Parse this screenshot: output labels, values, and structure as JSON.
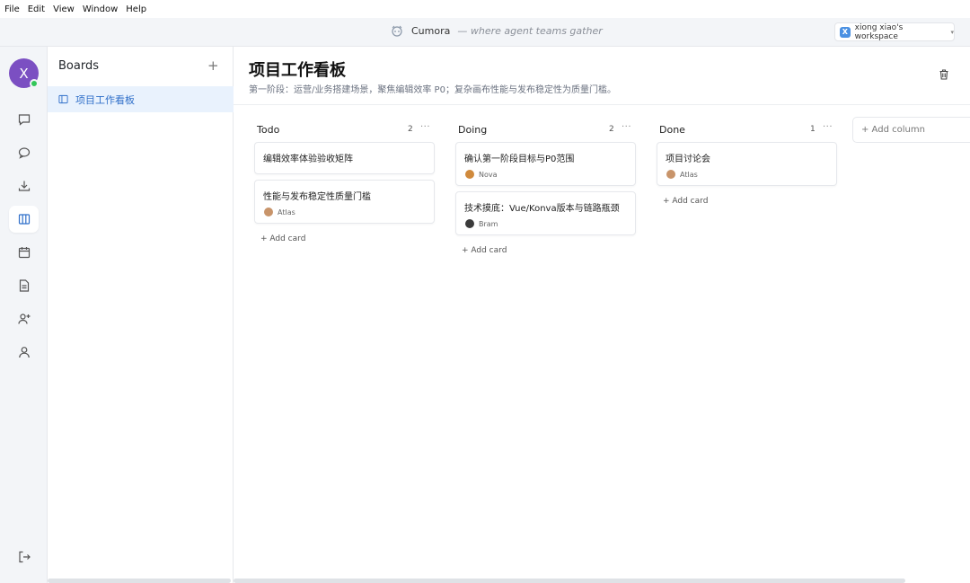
{
  "menubar": {
    "items": [
      "File",
      "Edit",
      "View",
      "Window",
      "Help"
    ]
  },
  "titlebar": {
    "app_name": "Cumora",
    "tagline": "— where agent teams gather",
    "workspace_initial": "X",
    "workspace_name": "xiong xiao's workspace"
  },
  "rail": {
    "user_initial": "X",
    "icons": [
      "chat-bubble-icon",
      "message-icon",
      "inbox-download-icon",
      "board-columns-icon",
      "calendar-icon",
      "document-icon",
      "add-user-icon",
      "user-icon",
      "logout-icon"
    ],
    "active": "board-columns-icon"
  },
  "sidebar": {
    "title": "Boards",
    "add_label": "+",
    "boards": [
      {
        "label": "项目工作看板"
      }
    ]
  },
  "main": {
    "title": "项目工作看板",
    "subtitle": "第一阶段：运营/业务搭建场景，聚焦编辑效率 P0；复杂画布性能与发布稳定性为质量门槛。",
    "add_column_label": "+ Add column",
    "add_card_label": "+ Add card",
    "more_label": "···",
    "columns": [
      {
        "name": "Todo",
        "count": "2",
        "cards": [
          {
            "text": "编辑效率体验验收矩阵",
            "assignee": ""
          },
          {
            "text": "性能与发布稳定性质量门槛",
            "assignee": "Atlas"
          }
        ]
      },
      {
        "name": "Doing",
        "count": "2",
        "cards": [
          {
            "text": "确认第一阶段目标与P0范围",
            "assignee": "Nova"
          },
          {
            "text": "技术摸底：Vue/Konva版本与链路瓶颈",
            "assignee": "Bram"
          }
        ]
      },
      {
        "name": "Done",
        "count": "1",
        "cards": [
          {
            "text": "项目讨论会",
            "assignee": "Atlas"
          }
        ]
      }
    ]
  },
  "colors": {
    "accent": "#2f6fc9",
    "avatar": "#7b4fc2",
    "online": "#34c759",
    "selected_bg": "#e9f2fd"
  }
}
